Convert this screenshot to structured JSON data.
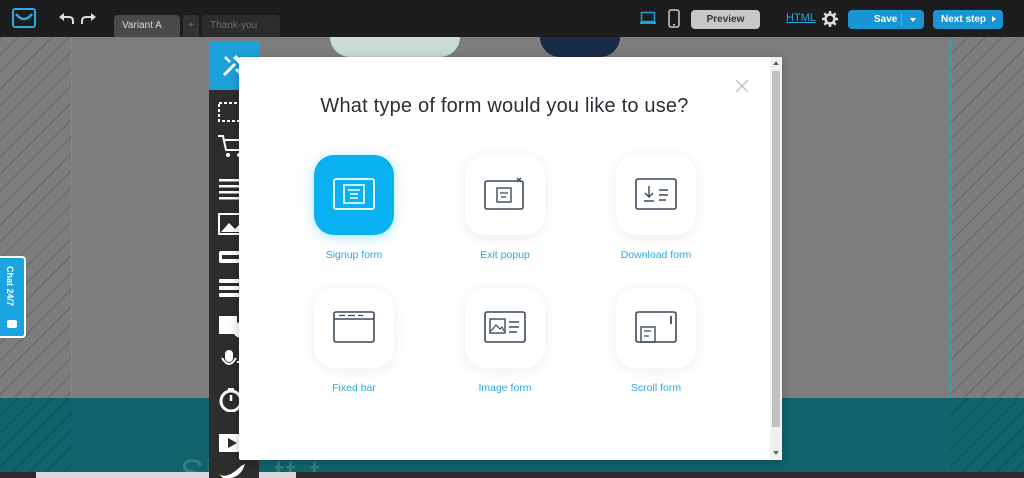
{
  "topbar": {
    "logo_icon": "getresponse-logo-icon",
    "tabs": [
      {
        "label": "Variant A",
        "active": true
      },
      {
        "label": "+",
        "active": false
      },
      {
        "label": "Thank-you page",
        "active": false
      }
    ],
    "preview_label": "Preview",
    "html_label": "HTML",
    "save_label": "Save",
    "next_step_label": "Next step"
  },
  "chat": {
    "label": "Chat 24/7"
  },
  "canvas": {
    "heading_partial": "Si      f           l   tt   t  "
  },
  "modal": {
    "title": "What type of form would you like to use?",
    "options": [
      {
        "label": "Signup form",
        "icon": "signup-form-icon",
        "selected": true
      },
      {
        "label": "Exit popup",
        "icon": "exit-popup-icon",
        "selected": false
      },
      {
        "label": "Download form",
        "icon": "download-form-icon",
        "selected": false
      },
      {
        "label": "Fixed bar",
        "icon": "fixed-bar-icon",
        "selected": false
      },
      {
        "label": "Image form",
        "icon": "image-form-icon",
        "selected": false
      },
      {
        "label": "Scroll form",
        "icon": "scroll-form-icon",
        "selected": false
      }
    ]
  },
  "tools": [
    "layout-icon",
    "cart-icon",
    "text-icon",
    "image-icon",
    "button-icon",
    "form-icon",
    "shape-icon",
    "audio-icon",
    "timer-icon",
    "video-icon",
    "social-icon"
  ],
  "colors": {
    "accent": "#0ab1f2",
    "link": "#28a9e1",
    "topbar": "#1d1d1d",
    "band": "#11646d"
  }
}
